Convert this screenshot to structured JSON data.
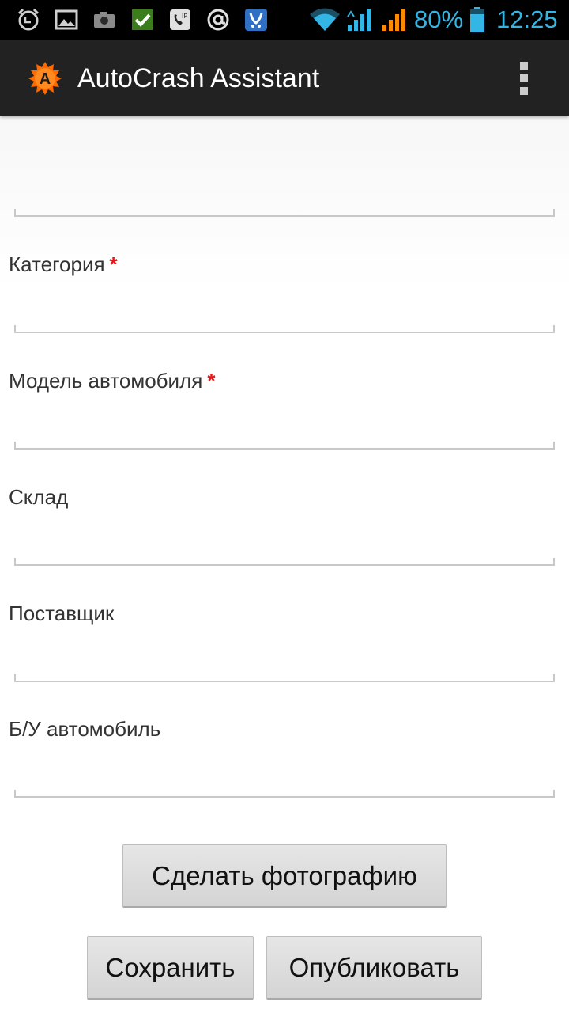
{
  "status_bar": {
    "battery": "80%",
    "time": "12:25",
    "icons": [
      "alarm-icon",
      "image-icon",
      "camera-icon",
      "checkbox-icon",
      "sip-call-icon",
      "at-sign-icon",
      "chat-app-icon",
      "wifi-icon",
      "signal-icon",
      "signal-icon",
      "battery-icon"
    ]
  },
  "action_bar": {
    "title": "AutoCrash Assistant",
    "logo_letter": "A",
    "logo_color": "#ff6a00"
  },
  "form": {
    "fields": [
      {
        "label": "",
        "value": ""
      },
      {
        "label": "Категория",
        "required_mark": "*",
        "value": ""
      },
      {
        "label": "Модель автомобиля",
        "required_mark": "*",
        "value": ""
      },
      {
        "label": "Склад",
        "value": ""
      },
      {
        "label": "Поставщик",
        "value": ""
      },
      {
        "label": "Б/У автомобиль",
        "value": ""
      }
    ]
  },
  "buttons": {
    "take_photo": "Сделать фотографию",
    "save": "Сохранить",
    "publish": "Опубликовать"
  },
  "colors": {
    "status_accent": "#33b5e5",
    "signal_secondary": "#ff8a00",
    "required": "#e8131b",
    "action_bar": "#222222"
  }
}
